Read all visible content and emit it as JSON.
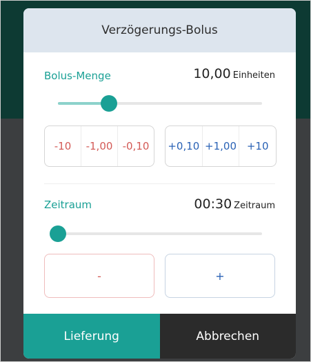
{
  "dialog": {
    "title": "Verzögerungs-Bolus"
  },
  "bolus": {
    "label": "Bolus-Menge",
    "value": "10,00",
    "unit": "Einheiten",
    "slider_fraction": 0.25,
    "minus_buttons": [
      "-10",
      "-1,00",
      "-0,10"
    ],
    "plus_buttons": [
      "+0,10",
      "+1,00",
      "+10"
    ]
  },
  "period": {
    "label": "Zeitraum",
    "value": "00:30",
    "unit": "Zeitraum",
    "slider_fraction": 0.0,
    "minus_label": "-",
    "plus_label": "+"
  },
  "footer": {
    "deliver_label": "Lieferung",
    "cancel_label": "Abbrechen"
  },
  "colors": {
    "accent": "#1aa095",
    "minus": "#d35a56",
    "plus": "#2a62b5",
    "header_bg": "#dde5ee",
    "cancel_bg": "#2b2b2b"
  }
}
